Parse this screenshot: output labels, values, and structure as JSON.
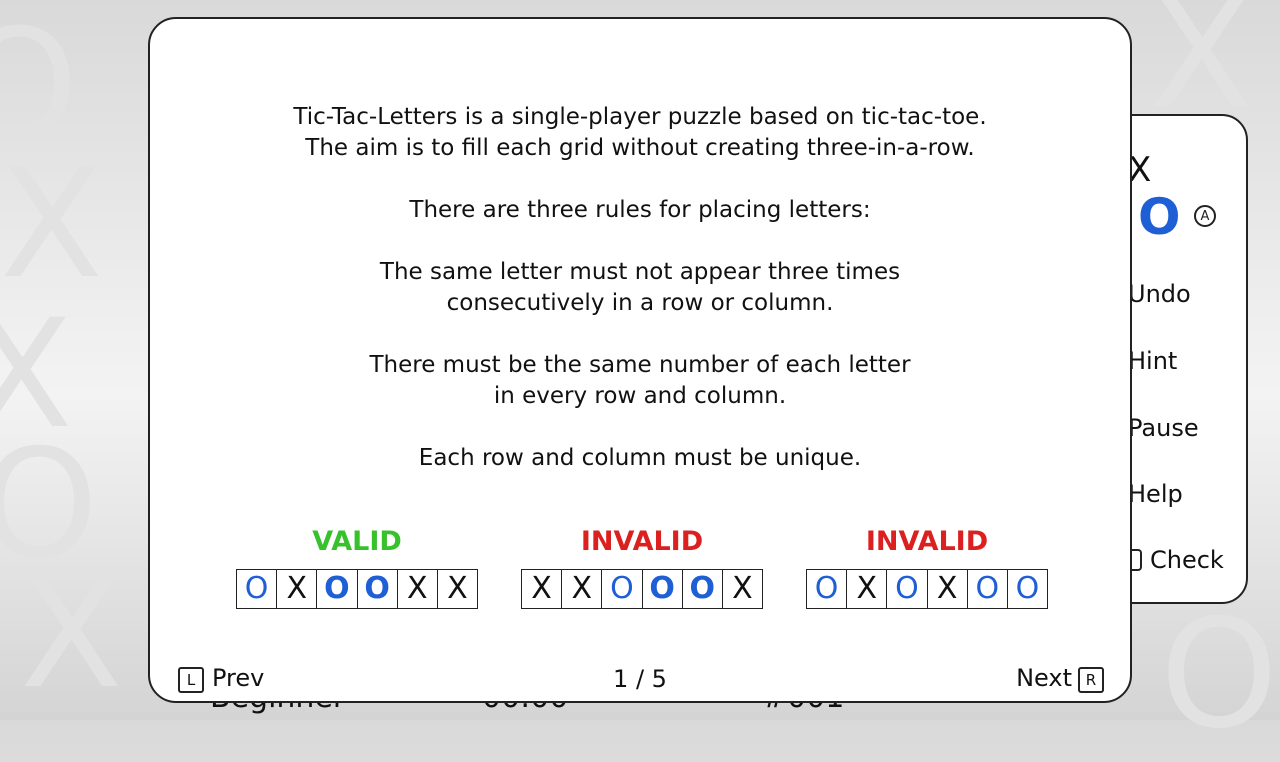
{
  "side_menu": {
    "x_symbol": "X",
    "o_symbol": "O",
    "a_button": "A",
    "items": [
      "Undo",
      "Hint",
      "Pause",
      "Help",
      "Check"
    ]
  },
  "status_bar": {
    "difficulty": "Beginner",
    "timer": "00:00",
    "puzzle_number": "#001"
  },
  "help": {
    "rules_lines": [
      "Tic-Tac-Letters is a single-player puzzle based on tic-tac-toe.",
      "The aim is to fill each grid without creating three-in-a-row.",
      "",
      "There are three rules for placing letters:",
      "",
      "The same letter must not appear three times",
      "consecutively in a row or column.",
      "",
      "There must be the same number of each letter",
      "in every row and column.",
      "",
      "Each row and column must be unique."
    ],
    "examples": [
      {
        "label": "VALID",
        "valid": true,
        "cells": [
          "O",
          "X",
          "O",
          "O",
          "X",
          "X"
        ],
        "bold": [
          false,
          false,
          true,
          true,
          false,
          false
        ]
      },
      {
        "label": "INVALID",
        "valid": false,
        "cells": [
          "X",
          "X",
          "O",
          "O",
          "O",
          "X"
        ],
        "bold": [
          false,
          false,
          false,
          true,
          true,
          false
        ]
      },
      {
        "label": "INVALID",
        "valid": false,
        "cells": [
          "O",
          "X",
          "O",
          "X",
          "O",
          "O"
        ],
        "bold": [
          false,
          false,
          false,
          false,
          false,
          false
        ]
      }
    ],
    "footer": {
      "prev_key": "L",
      "prev_label": "Prev",
      "page": "1 / 5",
      "next_label": "Next",
      "next_key": "R"
    }
  },
  "colors": {
    "o_blue": "#1f5fd6",
    "valid_green": "#37c12b",
    "invalid_red": "#dc1f1f"
  }
}
